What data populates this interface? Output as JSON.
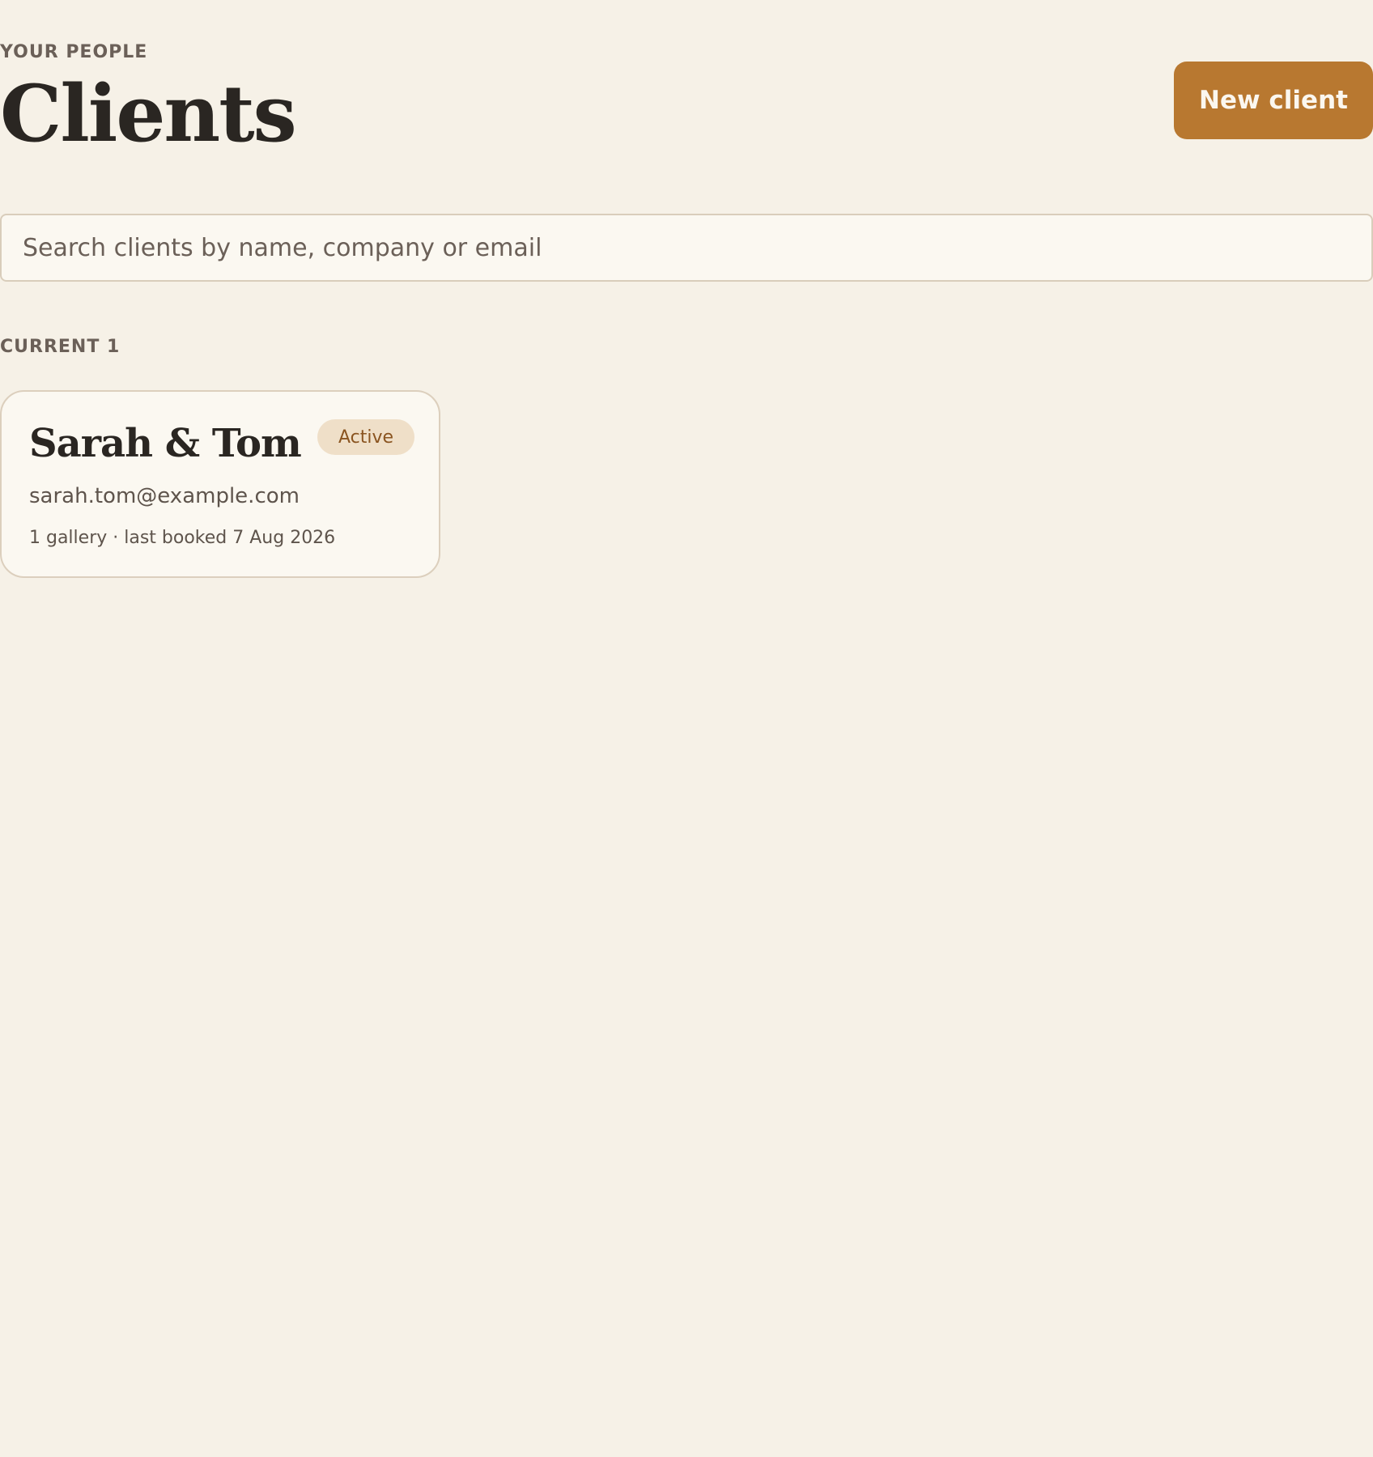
{
  "header": {
    "eyebrow": "YOUR PEOPLE",
    "title": "Clients",
    "new_client_label": "New client"
  },
  "search": {
    "placeholder": "Search clients by name, company or email",
    "value": ""
  },
  "sections": [
    {
      "label": "CURRENT 1",
      "clients": [
        {
          "name": "Sarah & Tom",
          "status": "Active",
          "email": "sarah.tom@example.com",
          "meta": "1 gallery · last booked 7 Aug 2026"
        }
      ]
    }
  ],
  "colors": {
    "background": "#f6f1e7",
    "accent": "#b87830",
    "card_background": "#fbf8f1",
    "badge_background": "#efdfc8",
    "badge_text": "#8a5420"
  }
}
